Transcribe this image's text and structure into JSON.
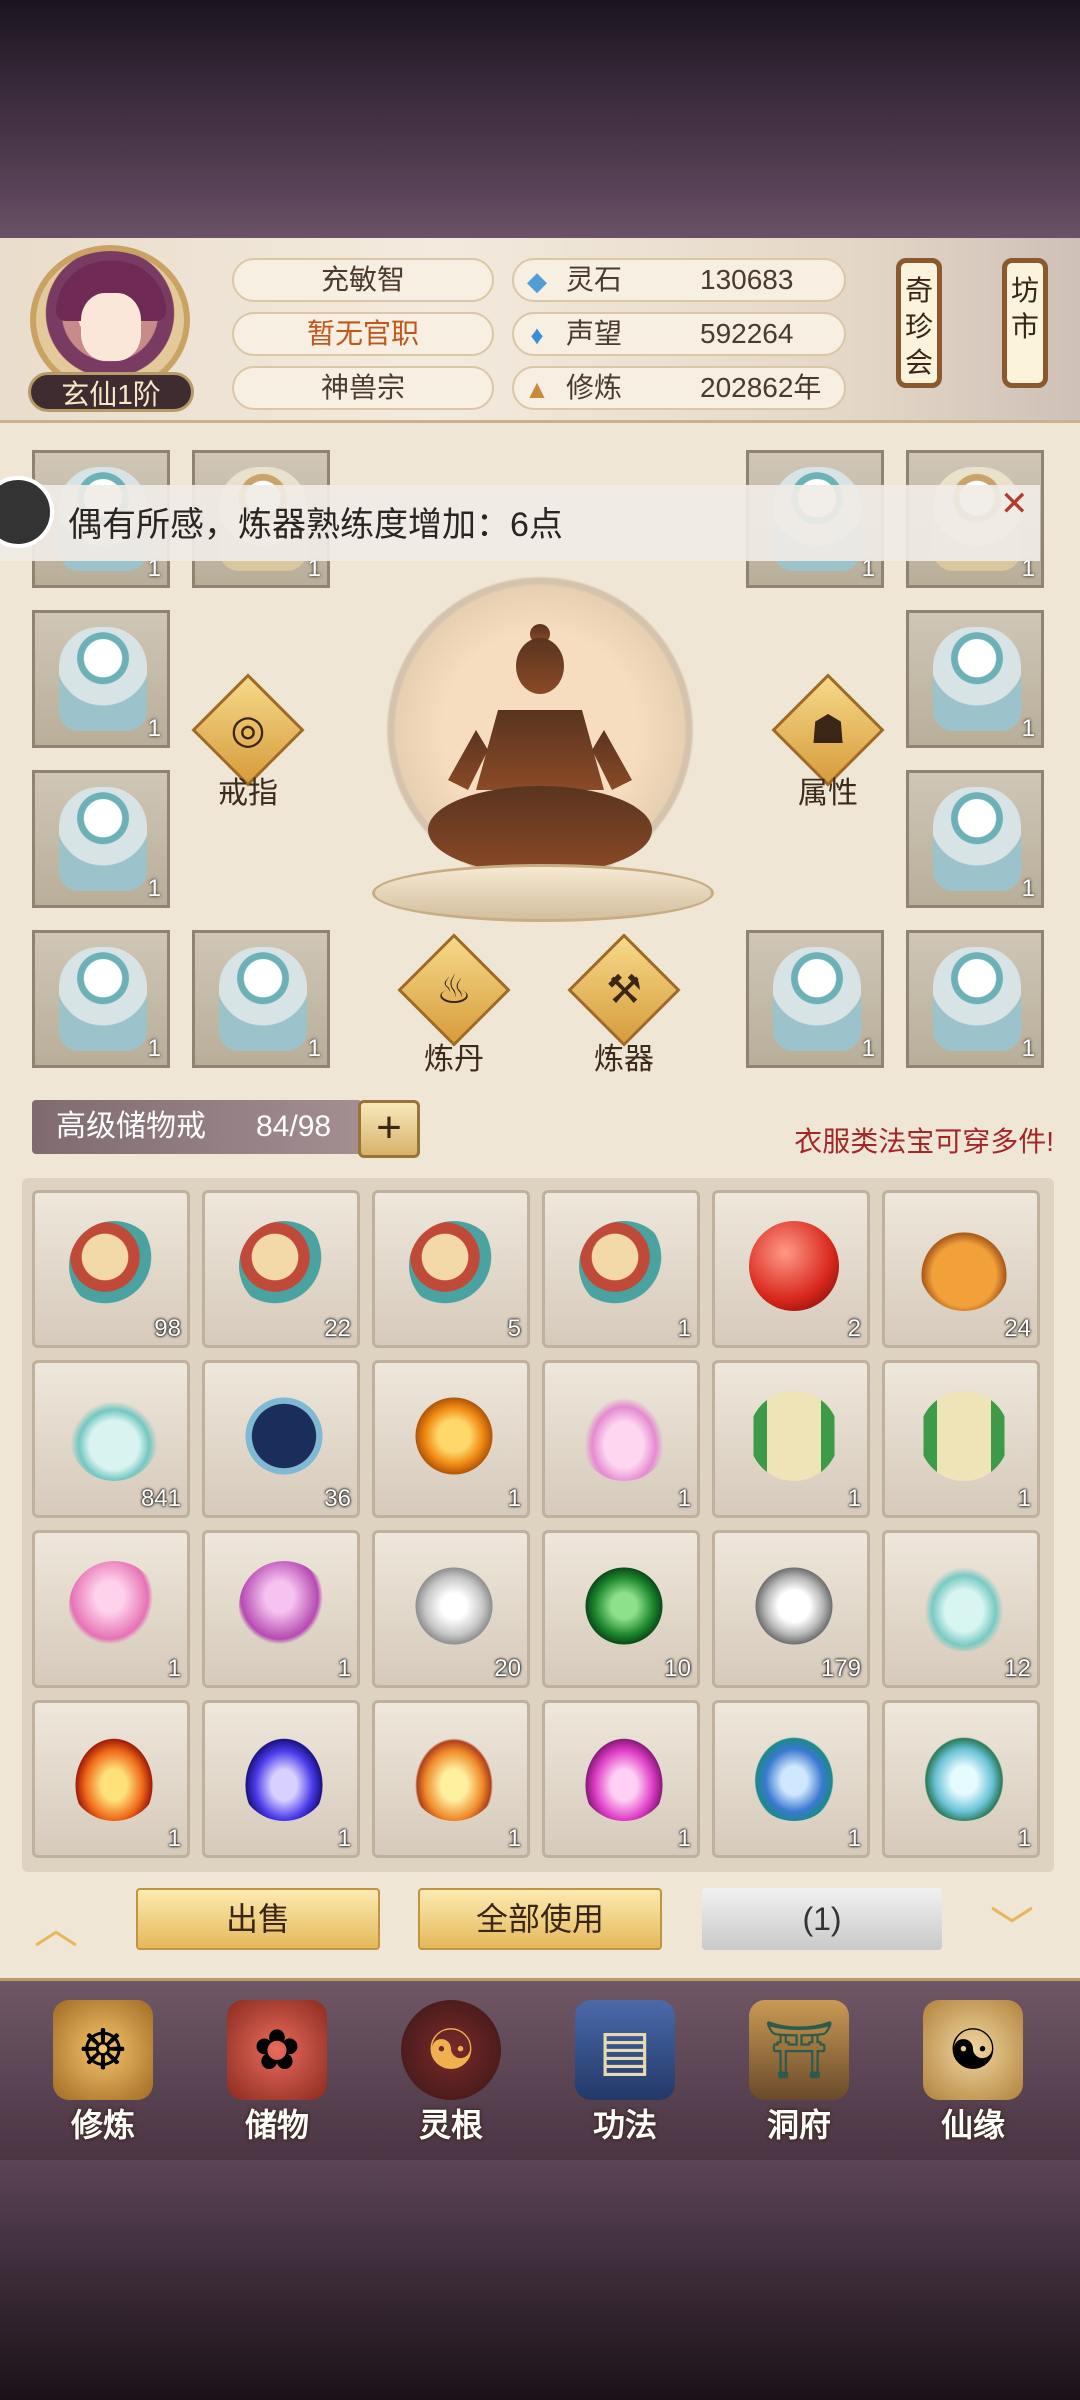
{
  "header": {
    "name": "充敏智",
    "official": "暂无官职",
    "sect": "神兽宗",
    "rank": "玄仙1阶",
    "resources": [
      {
        "icon": "spirit-stone-icon",
        "label": "灵石",
        "value": "130683"
      },
      {
        "icon": "reputation-icon",
        "label": "声望",
        "value": "592264"
      },
      {
        "icon": "cultivation-icon",
        "label": "修炼",
        "value": "202862年"
      }
    ],
    "side_buttons": [
      "奇珍会",
      "坊市"
    ]
  },
  "toast": {
    "text": "偶有所感，炼器熟练度增加：6点"
  },
  "equipment": {
    "slots": [
      {
        "count": "1"
      },
      {
        "count": "1"
      },
      {
        "count": "1"
      },
      {
        "count": "1"
      },
      {
        "count": "1"
      },
      {
        "count": "1"
      },
      {
        "count": "1"
      },
      {
        "count": "1"
      },
      {
        "count": "1"
      },
      {
        "count": "1"
      },
      {
        "count": "1"
      },
      {
        "count": "1"
      }
    ],
    "actions": [
      "戒指",
      "属性",
      "炼丹",
      "炼器"
    ]
  },
  "storage": {
    "name": "高级储物戒",
    "count": "84/98",
    "hint": "衣服类法宝可穿多件!"
  },
  "inventory": [
    {
      "icon": "scroll-bundle-icon",
      "count": "98"
    },
    {
      "icon": "scroll-bundle-icon",
      "count": "22"
    },
    {
      "icon": "scroll-bundle-icon",
      "count": "5"
    },
    {
      "icon": "scroll-bundle-icon",
      "count": "1"
    },
    {
      "icon": "red-orb-icon",
      "count": "2"
    },
    {
      "icon": "gourd-icon",
      "count": "24"
    },
    {
      "icon": "potion-bottle-icon",
      "count": "841"
    },
    {
      "icon": "star-chart-icon",
      "count": "36"
    },
    {
      "icon": "amber-gem-icon",
      "count": "1"
    },
    {
      "icon": "lotus-icon",
      "count": "1"
    },
    {
      "icon": "green-scroll-icon",
      "count": "1"
    },
    {
      "icon": "green-scroll-icon",
      "count": "1"
    },
    {
      "icon": "pink-egg-icon",
      "count": "1"
    },
    {
      "icon": "purple-egg-icon",
      "count": "1"
    },
    {
      "icon": "silver-orb-icon",
      "count": "20"
    },
    {
      "icon": "jade-orb-icon",
      "count": "10"
    },
    {
      "icon": "silver-swirl-icon",
      "count": "179"
    },
    {
      "icon": "cloud-charm-icon",
      "count": "12"
    },
    {
      "icon": "red-flame-icon",
      "count": "1"
    },
    {
      "icon": "blue-flame-icon",
      "count": "1"
    },
    {
      "icon": "fire-ring-icon",
      "count": "1"
    },
    {
      "icon": "pink-flame-icon",
      "count": "1"
    },
    {
      "icon": "water-drop-icon",
      "count": "1"
    },
    {
      "icon": "teal-drop-icon",
      "count": "1"
    }
  ],
  "actions": {
    "sell": "出售",
    "use_all": "全部使用",
    "quantity": "(1)"
  },
  "nav": [
    {
      "icon": "cultivate-icon",
      "label": "修炼"
    },
    {
      "icon": "storage-bag-icon",
      "label": "储物"
    },
    {
      "icon": "spirit-root-icon",
      "label": "灵根"
    },
    {
      "icon": "technique-book-icon",
      "label": "功法"
    },
    {
      "icon": "cave-mansion-icon",
      "label": "洞府"
    },
    {
      "icon": "fate-gourd-icon",
      "label": "仙缘"
    }
  ]
}
